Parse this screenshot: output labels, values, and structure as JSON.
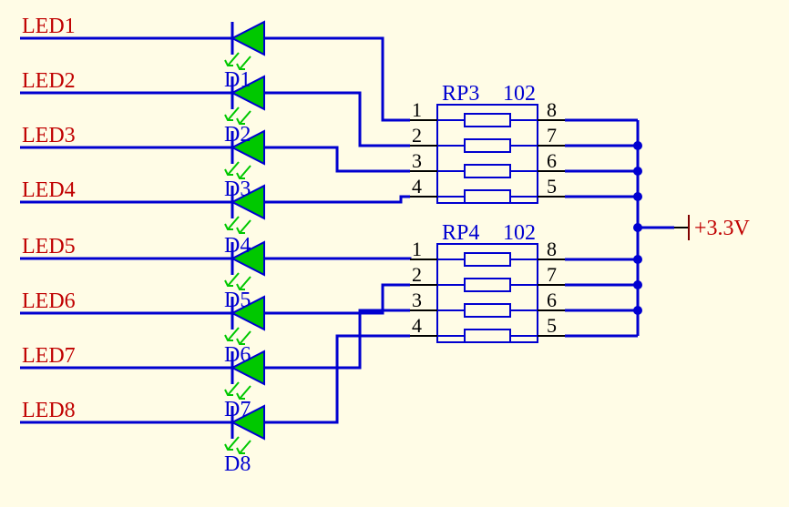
{
  "nets": {
    "led1": "LED1",
    "led2": "LED2",
    "led3": "LED3",
    "led4": "LED4",
    "led5": "LED5",
    "led6": "LED6",
    "led7": "LED7",
    "led8": "LED8"
  },
  "diodes": {
    "d1": "D1",
    "d2": "D2",
    "d3": "D3",
    "d4": "D4",
    "d5": "D5",
    "d6": "D6",
    "d7": "D7",
    "d8": "D8"
  },
  "resistor_packs": {
    "rp3": {
      "ref": "RP3",
      "val": "102"
    },
    "rp4": {
      "ref": "RP4",
      "val": "102"
    }
  },
  "pins": {
    "p1": "1",
    "p2": "2",
    "p3": "3",
    "p4": "4",
    "p5": "5",
    "p6": "6",
    "p7": "7",
    "p8": "8"
  },
  "power": {
    "rail": "+3.3V"
  }
}
